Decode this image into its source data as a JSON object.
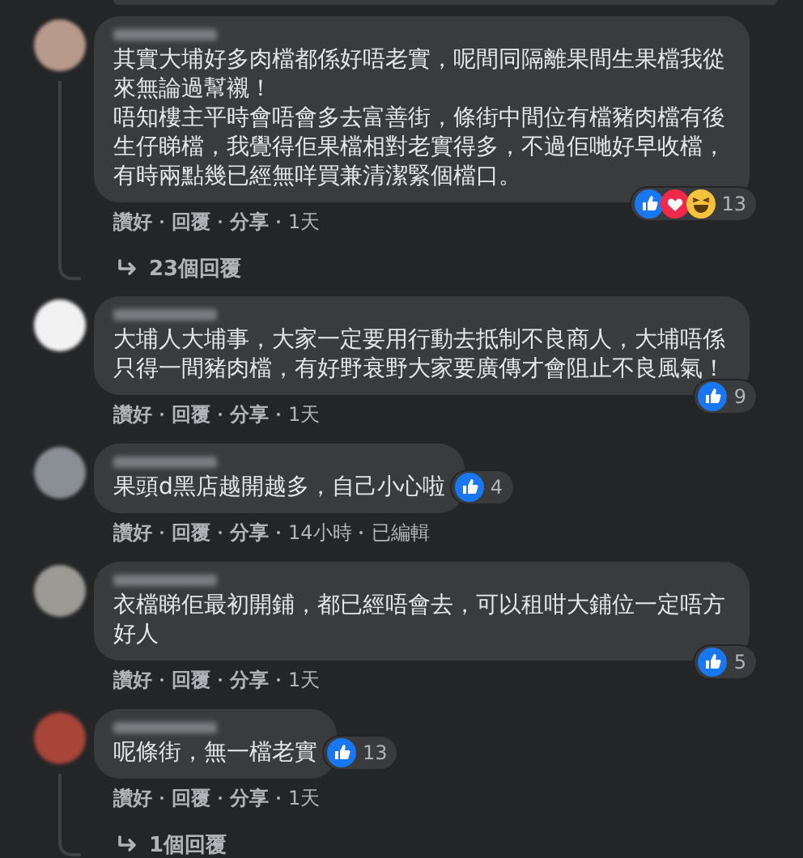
{
  "comments": [
    {
      "color": "#b89a8c",
      "paragraphs": [
        "其實大埔好多肉檔都係好唔老實，呢間同隔離果間生果檔我從來無論過幫襯！",
        "唔知樓主平時會唔會多去富善街，條街中間位有檔豬肉檔有後生仔睇檔，我覺得佢果檔相對老實得多，不過佢哋好早收檔，有時兩點幾已經無咩買兼清潔緊個檔口。"
      ],
      "reactions": [
        {
          "kind": "like"
        },
        {
          "kind": "love"
        },
        {
          "kind": "haha"
        }
      ],
      "reaction_count": "13",
      "actions": [
        "讚好",
        "回覆",
        "分享",
        "1天"
      ],
      "replies": "23個回覆"
    },
    {
      "color": "#f2f2f2",
      "paragraphs": [
        "大埔人大埔事，大家一定要用行動去抵制不良商人，大埔唔係只得一間豬肉檔，有好野衰野大家要廣傳才會阻止不良風氣！"
      ],
      "reactions": [
        {
          "kind": "like"
        }
      ],
      "reaction_count": "9",
      "actions": [
        "讚好",
        "回覆",
        "分享",
        "1天"
      ]
    },
    {
      "color": "#8a8f95",
      "paragraphs": [
        "果頭d黑店越開越多，自己小心啦"
      ],
      "reactions": [
        {
          "kind": "like"
        }
      ],
      "reaction_count": "4",
      "actions": [
        "讚好",
        "回覆",
        "分享",
        "14小時",
        "已編輯"
      ]
    },
    {
      "color": "#9c9a94",
      "paragraphs": [
        "衣檔睇佢最初開鋪，都已經唔會去，可以租咁大鋪位一定唔方好人"
      ],
      "reactions": [
        {
          "kind": "like"
        }
      ],
      "reaction_count": "5",
      "actions": [
        "讚好",
        "回覆",
        "分享",
        "1天"
      ]
    },
    {
      "color": "#a8453a",
      "paragraphs": [
        "呢條街，無一檔老實"
      ],
      "reactions": [
        {
          "kind": "like"
        }
      ],
      "reaction_count": "13",
      "actions": [
        "讚好",
        "回覆",
        "分享",
        "1天"
      ],
      "replies": "1個回覆"
    }
  ]
}
